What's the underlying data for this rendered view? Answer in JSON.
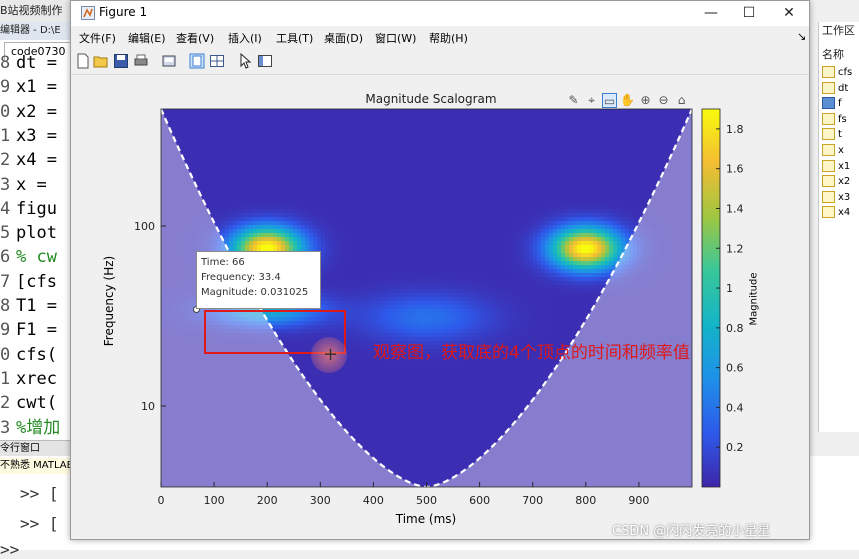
{
  "desktop": {
    "top_title": "B站视频制作",
    "editor_bar": "编辑器 - D:\\E",
    "editor_tab": "code0730",
    "code_lines": [
      {
        "num": "8",
        "text": "dt =",
        "comment": false
      },
      {
        "num": "9",
        "text": "x1 =",
        "comment": false
      },
      {
        "num": "0",
        "text": "x2 =",
        "comment": false
      },
      {
        "num": "1",
        "text": "x3 =",
        "comment": false
      },
      {
        "num": "2",
        "text": "x4 =",
        "comment": false
      },
      {
        "num": "3",
        "text": "x =",
        "comment": false
      },
      {
        "num": "4",
        "text": "figu",
        "comment": false
      },
      {
        "num": "5",
        "text": "plot",
        "comment": false
      },
      {
        "num": "6",
        "text": "% cw",
        "comment": true
      },
      {
        "num": "7",
        "text": "[cfs",
        "comment": false
      },
      {
        "num": "8",
        "text": "T1 =",
        "comment": false
      },
      {
        "num": "9",
        "text": "F1 =",
        "comment": false
      },
      {
        "num": "0",
        "text": "cfs(",
        "comment": false
      },
      {
        "num": "1",
        "text": "xrec",
        "comment": false
      },
      {
        "num": "2",
        "text": "cwt(",
        "comment": false
      },
      {
        "num": "3",
        "text": "%增加",
        "comment": true
      }
    ],
    "cmd_window_bar": "令行窗口",
    "cmd_hint": "不熟悉 MATLAB",
    "prompts": [
      ">> [",
      ">> ["
    ],
    "bottom_prompt": ">>",
    "workspace": {
      "title": "工作区",
      "header": "名称",
      "vars": [
        {
          "name": "cfs",
          "selected": false
        },
        {
          "name": "dt",
          "selected": false
        },
        {
          "name": "f",
          "selected": true
        },
        {
          "name": "fs",
          "selected": false
        },
        {
          "name": "t",
          "selected": false
        },
        {
          "name": "x",
          "selected": false
        },
        {
          "name": "x1",
          "selected": false
        },
        {
          "name": "x2",
          "selected": false
        },
        {
          "name": "x3",
          "selected": false
        },
        {
          "name": "x4",
          "selected": false
        }
      ]
    }
  },
  "figure": {
    "window_title": "Figure 1",
    "window_buttons": [
      "—",
      "☐",
      "✕"
    ],
    "menus": [
      "文件(F)",
      "编辑(E)",
      "查看(V)",
      "插入(I)",
      "工具(T)",
      "桌面(D)",
      "窗口(W)",
      "帮助(H)"
    ],
    "menu_arrow": "↘",
    "toolbar_icons": [
      "new-figure-icon",
      "open-icon",
      "save-icon",
      "print-icon",
      "link-icon",
      "toggle-plot-icon",
      "subplot-icon",
      "pointer-icon",
      "property-icon"
    ],
    "axes_toolbar_icons": [
      "brush-icon",
      "datatip-icon",
      "restore-view-icon",
      "pan-icon",
      "zoom-in-icon",
      "zoom-out-icon",
      "home-icon"
    ]
  },
  "chart_data": {
    "type": "heatmap",
    "title": "Magnitude Scalogram",
    "xlabel": "Time (ms)",
    "ylabel": "Frequency (Hz)",
    "x_ticks": [
      "0",
      "100",
      "200",
      "300",
      "400",
      "500",
      "600",
      "700",
      "800",
      "900"
    ],
    "xlim": [
      0,
      1000
    ],
    "y_scale": "log",
    "y_ticks": [
      "100",
      "10"
    ],
    "colorbar": {
      "label": "Magnitude",
      "ticks": [
        "1.8",
        "1.6",
        "1.4",
        "1.2",
        "1",
        "0.8",
        "0.6",
        "0.4",
        "0.2"
      ],
      "range": [
        0,
        1.9
      ]
    },
    "colormap": [
      "#3e26a8",
      "#2e5aeb",
      "#1f90e8",
      "#13b4c8",
      "#38c79a",
      "#9fc641",
      "#f3bd33",
      "#f9fb0e"
    ],
    "blobs": [
      {
        "time_ms": 200,
        "freq_hz": 75,
        "peak": 1.9,
        "time_spread_ms": 45,
        "freq_spread_log": 0.08
      },
      {
        "time_ms": 800,
        "freq_hz": 75,
        "peak": 1.9,
        "time_spread_ms": 45,
        "freq_spread_log": 0.08
      },
      {
        "time_ms": 200,
        "freq_hz": 34,
        "peak": 0.7,
        "time_spread_ms": 70,
        "freq_spread_log": 0.06
      },
      {
        "time_ms": 500,
        "freq_hz": 31,
        "peak": 0.35,
        "time_spread_ms": 80,
        "freq_spread_log": 0.09
      }
    ],
    "datatip": {
      "time_label": "Time: 66",
      "frequency_label": "Frequency: 33.4",
      "magnitude_label": "Magnitude: 0.031025"
    }
  },
  "annotation": {
    "text": "观察图，获取底的4个顶点的时间和频率值"
  },
  "watermark": "CSDN @闪闪发亮的小星星"
}
